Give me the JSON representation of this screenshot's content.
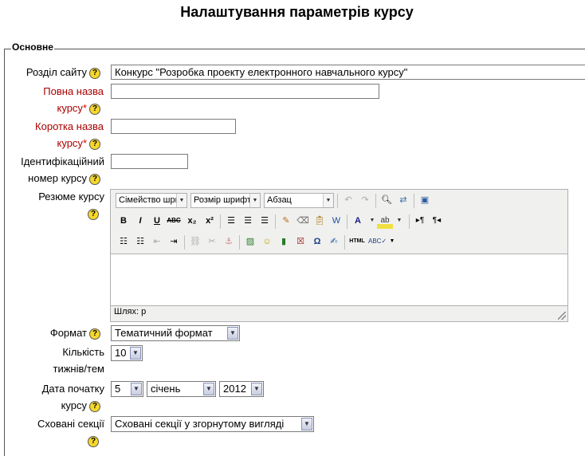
{
  "page": {
    "title": "Налаштування параметрів курсу"
  },
  "section": {
    "legend": "Основне"
  },
  "fields": {
    "category": {
      "label": "Розділ сайту",
      "value": "Конкурс \"Розробка проекту електронного навчального курсу\""
    },
    "fullname": {
      "label_line1": "Повна назва",
      "label_line2": "курсу",
      "value": ""
    },
    "shortname": {
      "label_line1": "Коротка назва",
      "label_line2": "курсу",
      "value": ""
    },
    "idnumber": {
      "label_line1": "Ідентифікаційний",
      "label_line2": "номер курсу",
      "value": ""
    },
    "summary": {
      "label": "Резюме курсу"
    },
    "format": {
      "label": "Формат",
      "value": "Тематичний формат"
    },
    "numsections": {
      "label_line1": "Кількість",
      "label_line2": "тижнів/тем",
      "value": "10"
    },
    "startdate": {
      "label_line1": "Дата початку",
      "label_line2": "курсу",
      "day": "5",
      "month": "січень",
      "year": "2012"
    },
    "hiddensections": {
      "label": "Сховані секції",
      "value": "Сховані секції у згорнутому вигляді"
    }
  },
  "editor": {
    "font_family": "Сімейство шри",
    "font_size": "Розмір шрифта",
    "block_format": "Абзац",
    "path_label": "Шлях: p"
  },
  "icons": {
    "help": "?",
    "required": "*",
    "dropdown": "▼"
  }
}
